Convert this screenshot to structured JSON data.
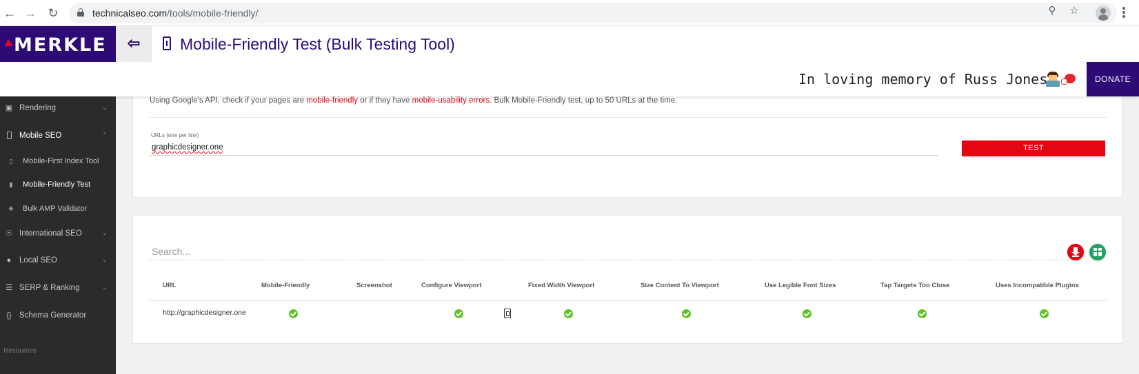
{
  "browser": {
    "url_host": "technicalseo.com",
    "url_path": "/tools/mobile-friendly/"
  },
  "header": {
    "logo": "MERKLE",
    "title": "Mobile-Friendly Test (Bulk Testing Tool)",
    "memorial": "In loving memory of Russ Jones",
    "donate_label": "DONATE"
  },
  "sidebar": {
    "items": [
      {
        "label": "Rendering",
        "icon": "monitor-icon"
      },
      {
        "label": "Mobile SEO",
        "icon": "phone-icon"
      },
      {
        "label": "International SEO",
        "icon": "globe-icon"
      },
      {
        "label": "Local SEO",
        "icon": "pin-icon"
      },
      {
        "label": "SERP & Ranking",
        "icon": "list-icon"
      },
      {
        "label": "Schema Generator",
        "icon": "braces-icon"
      }
    ],
    "subitems": [
      {
        "label": "Mobile-First Index Tool"
      },
      {
        "label": "Mobile-Friendly Test"
      },
      {
        "label": "Bulk AMP Validator"
      }
    ],
    "resources_label": "Resources"
  },
  "form": {
    "intro_before": "Using Google's API, check if your pages are ",
    "intro_hl1": "mobile-friendly",
    "intro_mid": " or if they have ",
    "intro_hl2": "mobile-usability errors",
    "intro_after": ". Bulk Mobile-Friendly test, up to 50 URLs at the time.",
    "urls_label": "URLs (one per line)",
    "urls_value": "graphicdesigner.one",
    "test_label": "TEST"
  },
  "results": {
    "search_placeholder": "Search...",
    "columns": [
      "URL",
      "Mobile-Friendly",
      "Screenshot",
      "Configure Viewport",
      "Fixed Width Viewport",
      "Size Content To Viewport",
      "Use Legible Font Sizes",
      "Tap Targets Too Close",
      "Uses Incompatible Plugins"
    ],
    "rows": [
      {
        "url": "http://graphicdesigner.one"
      }
    ]
  },
  "colors": {
    "brand": "#2d0a76",
    "accent": "#e30613",
    "success": "#5cc424",
    "sheets": "#1fa463"
  }
}
